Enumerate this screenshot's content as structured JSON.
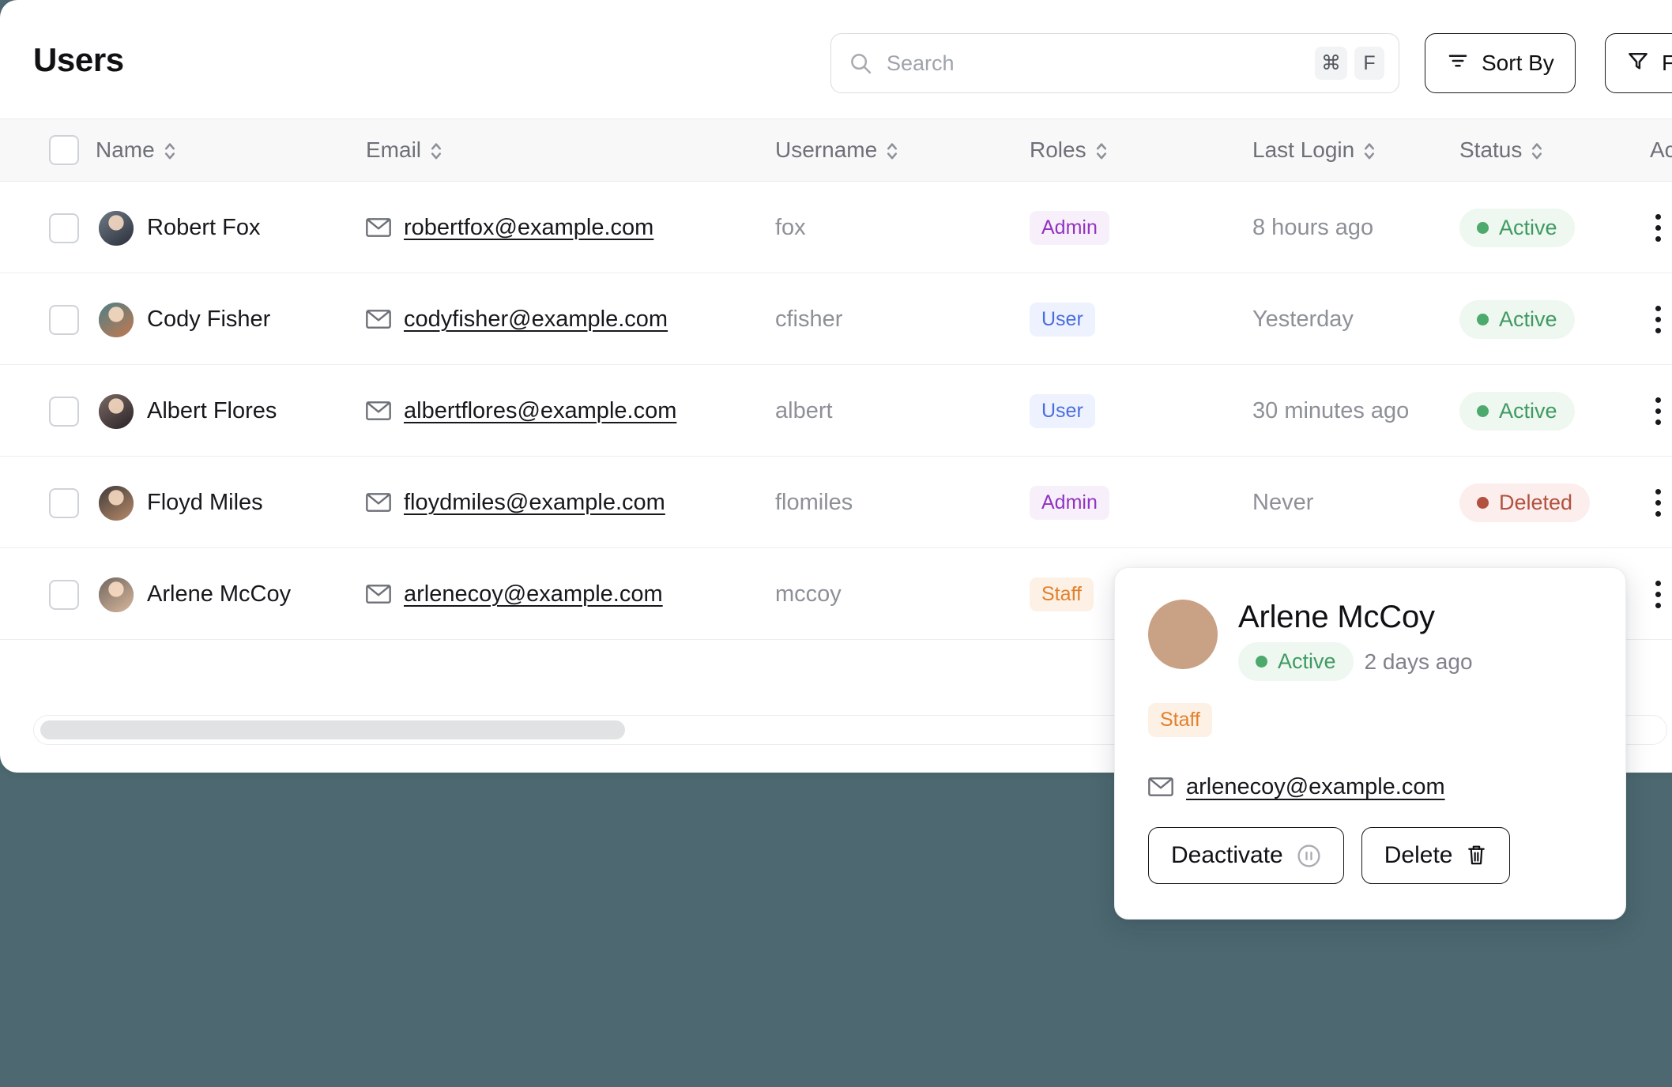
{
  "header": {
    "title": "Users",
    "search": {
      "placeholder": "Search",
      "kbd_modifier": "⌘",
      "kbd_key": "F"
    },
    "sort_button": "Sort By",
    "filter_button": "F"
  },
  "table": {
    "columns": [
      {
        "label": "Name"
      },
      {
        "label": "Email"
      },
      {
        "label": "Username"
      },
      {
        "label": "Roles"
      },
      {
        "label": "Last Login"
      },
      {
        "label": "Status"
      },
      {
        "label": "Ac"
      }
    ],
    "rows": [
      {
        "name": "Robert Fox",
        "email": "robertfox@example.com",
        "username": "fox",
        "role": "Admin",
        "role_kind": "admin",
        "last_login": "8 hours ago",
        "status": "Active",
        "status_kind": "active",
        "avatar_a": "#2b2f3a",
        "avatar_b": "#6f7b86"
      },
      {
        "name": "Cody Fisher",
        "email": "codyfisher@example.com",
        "username": "cfisher",
        "role": "User",
        "role_kind": "user",
        "last_login": "Yesterday",
        "status": "Active",
        "status_kind": "active",
        "avatar_a": "#c4794f",
        "avatar_b": "#4e7f86"
      },
      {
        "name": "Albert Flores",
        "email": "albertflores@example.com",
        "username": "albert",
        "role": "User",
        "role_kind": "user",
        "last_login": "30 minutes ago",
        "status": "Active",
        "status_kind": "active",
        "avatar_a": "#2a2228",
        "avatar_b": "#7a6a63"
      },
      {
        "name": "Floyd Miles",
        "email": "floydmiles@example.com",
        "username": "flomiles",
        "role": "Admin",
        "role_kind": "admin",
        "last_login": "Never",
        "status": "Deleted",
        "status_kind": "deleted",
        "avatar_a": "#b98a6a",
        "avatar_b": "#3e3b39"
      },
      {
        "name": "Arlene McCoy",
        "email": "arlenecoy@example.com",
        "username": "mccoy",
        "role": "Staff",
        "role_kind": "staff",
        "last_login": "",
        "status": "",
        "status_kind": "",
        "avatar_a": "#d9b79b",
        "avatar_b": "#6f6660"
      }
    ]
  },
  "popover": {
    "name": "Arlene McCoy",
    "status": "Active",
    "last_login": "2 days ago",
    "role": "Staff",
    "email": "arlenecoy@example.com",
    "deactivate_label": "Deactivate",
    "delete_label": "Delete"
  },
  "colors": {
    "background": "#4d6870",
    "admin": "#9333c2",
    "user": "#4a6ee0",
    "staff": "#e2802c",
    "active": "#3f9a62",
    "deleted": "#b2513e"
  }
}
